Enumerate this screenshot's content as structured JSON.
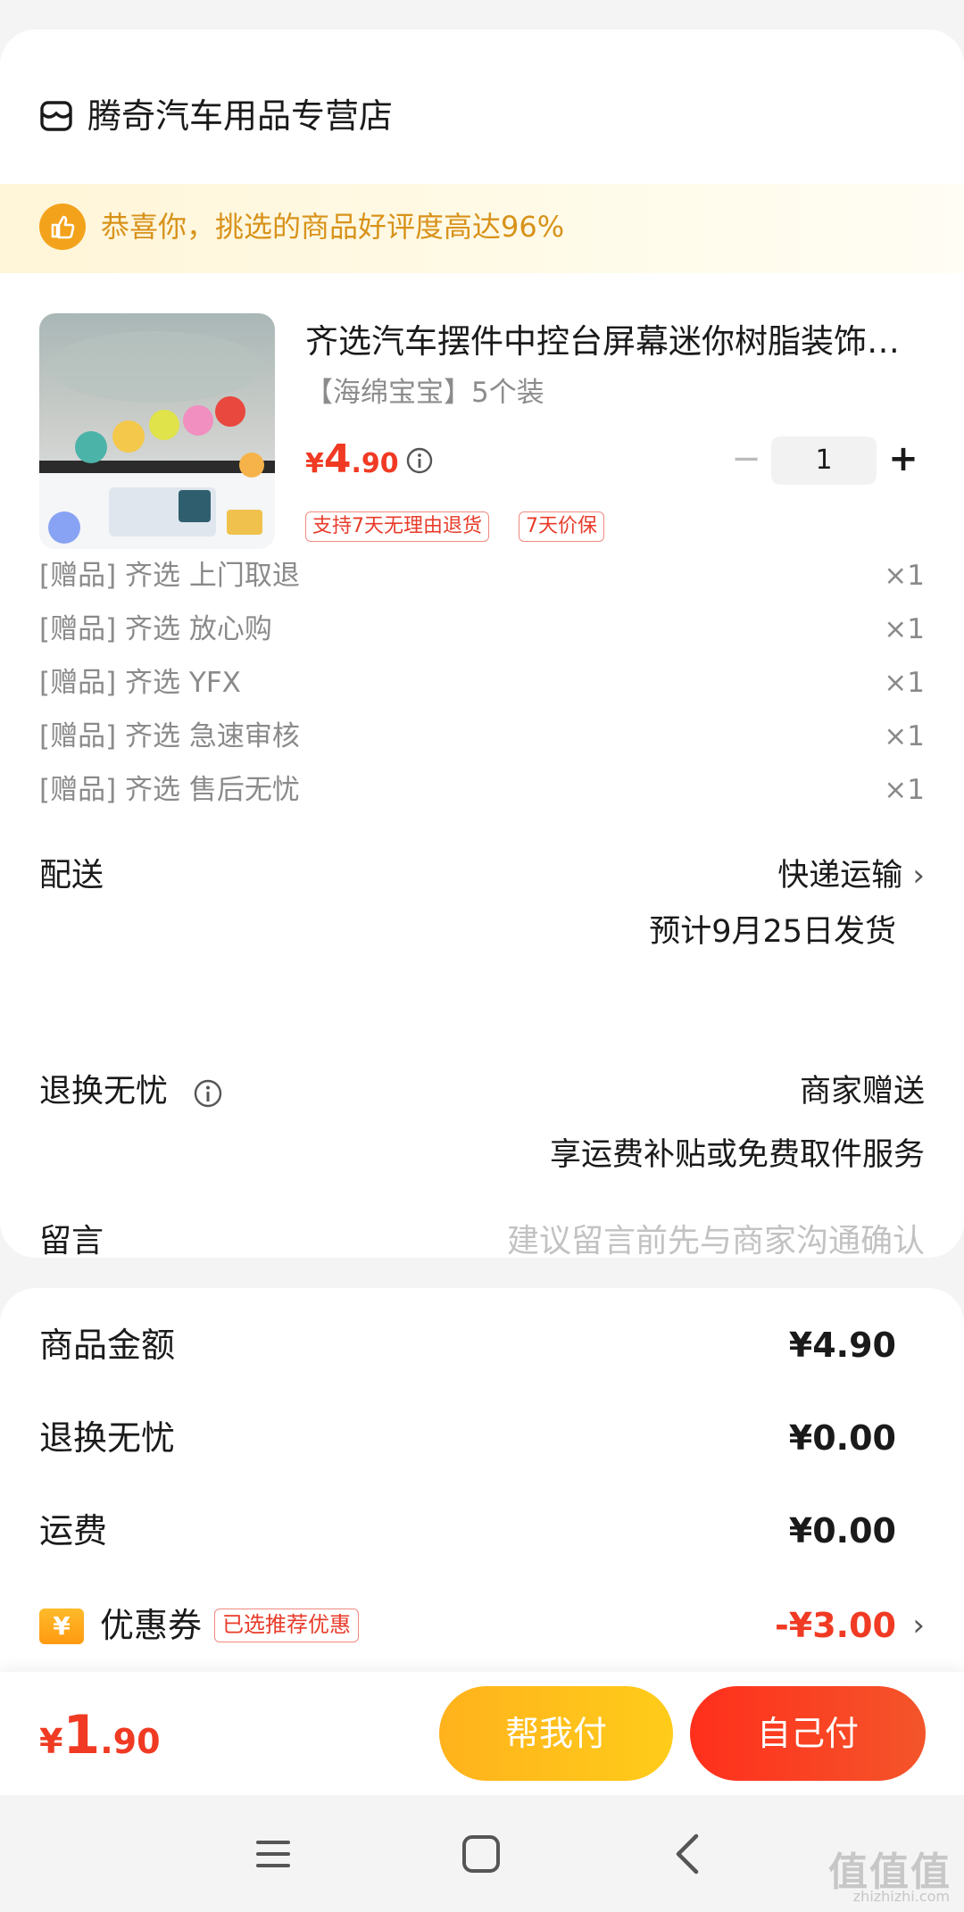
{
  "store": {
    "name": "腾奇汽车用品专营店"
  },
  "banner": {
    "text": "恭喜你，挑选的商品好评度高达96%"
  },
  "product": {
    "title": "齐选汽车摆件中控台屏幕迷你树脂装饰…",
    "spec": "【海绵宝宝】5个装",
    "price_symbol": "¥",
    "price_int": "4",
    "price_dec": ".90",
    "quantity": "1",
    "minus": "−",
    "plus": "+",
    "tags": [
      "支持7天无理由退货",
      "7天价保"
    ]
  },
  "gifts": [
    {
      "label": "[赠品] 齐选 上门取退",
      "qty": "×1"
    },
    {
      "label": "[赠品] 齐选 放心购",
      "qty": "×1"
    },
    {
      "label": "[赠品] 齐选 YFX",
      "qty": "×1"
    },
    {
      "label": "[赠品] 齐选 急速审核",
      "qty": "×1"
    },
    {
      "label": "[赠品] 齐选 售后无忧",
      "qty": "×1"
    }
  ],
  "delivery": {
    "label": "配送",
    "method": "快递运输",
    "estimate": "预计9月25日发货"
  },
  "return_service": {
    "label": "退换无忧",
    "value": "商家赠送",
    "desc": "享运费补贴或免费取件服务"
  },
  "message": {
    "label": "留言",
    "placeholder": "建议留言前先与商家沟通确认"
  },
  "summary": {
    "goods_label": "商品金额",
    "goods_value": "¥4.90",
    "return_label": "退换无忧",
    "return_value": "¥0.00",
    "shipping_label": "运费",
    "shipping_value": "¥0.00",
    "coupon_label": "优惠券",
    "coupon_tag": "已选推荐优惠",
    "coupon_value": "-¥3.00",
    "coupon_icon": "¥"
  },
  "footer": {
    "total_symbol": "¥",
    "total_int": "1",
    "total_dec": ".90",
    "help_pay": "帮我付",
    "self_pay": "自己付"
  },
  "system_nav": {
    "watermark": "值值值",
    "watermark_sub": "zhizhizhi.com"
  },
  "colors": {
    "accent_red": "#f03a23",
    "banner_gold": "#d8921a",
    "help_btn": "#ffbe1b",
    "self_btn": "#f63a21"
  }
}
